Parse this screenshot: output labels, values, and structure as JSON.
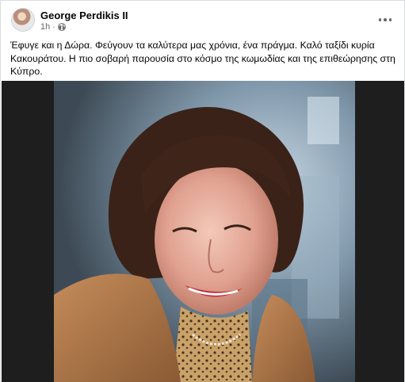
{
  "post": {
    "author": "George Perdikis II",
    "time": "1h",
    "separator": "·",
    "audience_icon": "globe-icon",
    "more_icon": "more-horizontal-icon",
    "text": "Έφυγε και η Δώρα. Φεύγουν τα καλύτερα μας χρόνια, ένα πράγμα. Καλό ταξίδι κυρία Κακουράτου. Η πιο σοβαρή παρουσία στο κόσμο της κωμωδίας και της επιθεώρησης στη Κύπρο."
  },
  "colors": {
    "text_primary": "#050505",
    "text_secondary": "#65676b",
    "media_background": "#1e1e1e",
    "border": "#dadde1"
  }
}
